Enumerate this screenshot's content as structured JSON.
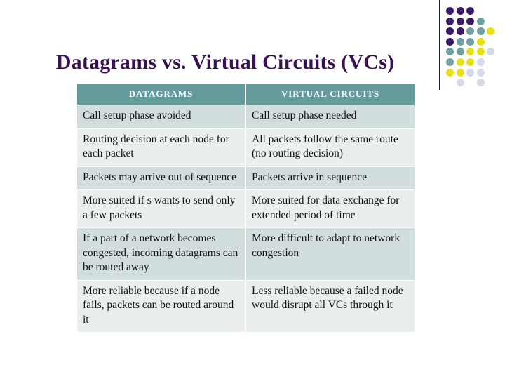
{
  "slide": {
    "title": "Datagrams vs. Virtual Circuits (VCs)",
    "background_color": "#ffffff",
    "title_color": "#3a1055"
  },
  "decoration": {
    "name": "dot-grid-decoration",
    "rule_color": "#1c1c2e",
    "colors": {
      "purple": "#3b1a6b",
      "teal": "#6fa0a4",
      "yellow": "#e8e111",
      "lavender": "#d6d9e8"
    },
    "grid": [
      [
        "purple",
        "purple",
        "purple",
        "",
        ""
      ],
      [
        "purple",
        "purple",
        "purple",
        "teal",
        ""
      ],
      [
        "purple",
        "purple",
        "teal",
        "teal",
        "yellow"
      ],
      [
        "purple",
        "teal",
        "teal",
        "yellow",
        ""
      ],
      [
        "teal",
        "teal",
        "yellow",
        "yellow",
        "lavender"
      ],
      [
        "teal",
        "yellow",
        "yellow",
        "lavender",
        ""
      ],
      [
        "yellow",
        "yellow",
        "lavender",
        "lavender",
        ""
      ],
      [
        "",
        "lavender",
        "",
        "lavender",
        ""
      ]
    ]
  },
  "table": {
    "name": "datagrams-vs-virtual-circuits-table",
    "header_background": "#639b9d",
    "header_text_color": "#ffffff",
    "row_colors": [
      "#d2dedd",
      "#eaeeed"
    ],
    "columns": [
      "DATAGRAMS",
      "VIRTUAL CIRCUITS"
    ],
    "rows": [
      {
        "datagrams": "Call setup phase avoided",
        "virtual_circuits": "Call setup phase needed"
      },
      {
        "datagrams": "Routing decision at each node for each packet",
        "virtual_circuits": "All packets follow the same route (no routing decision)"
      },
      {
        "datagrams": "Packets may arrive out of sequence",
        "virtual_circuits": "Packets arrive in sequence"
      },
      {
        "datagrams": "More suited if s wants to send only a few packets",
        "virtual_circuits": "More suited for data exchange for extended period of time"
      },
      {
        "datagrams": "If a part of a network becomes congested, incoming datagrams can be routed away",
        "virtual_circuits": "More difficult to adapt to network congestion"
      },
      {
        "datagrams": "More reliable because if a node fails, packets can be routed around it",
        "virtual_circuits": "Less reliable because a failed node would disrupt all VCs through it"
      }
    ]
  }
}
